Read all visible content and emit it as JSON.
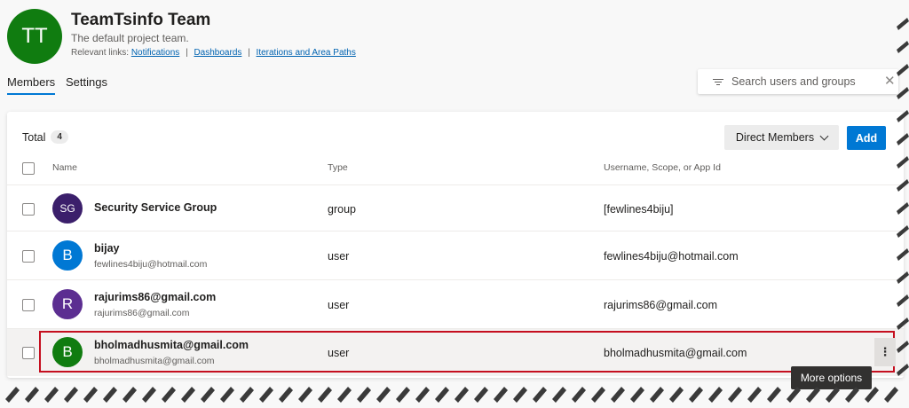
{
  "team": {
    "initials": "TT",
    "name": "TeamTsinfo Team",
    "description": "The default project team.",
    "relevant_label": "Relevant links:",
    "links": [
      "Notifications",
      "Dashboards",
      "Iterations and Area Paths"
    ],
    "separator": "|",
    "avatar_color": "#107c10"
  },
  "tabs": [
    {
      "label": "Members",
      "selected": true
    },
    {
      "label": "Settings",
      "selected": false
    }
  ],
  "search": {
    "placeholder": "Search users and groups",
    "value": "",
    "filter_icon": "filter-icon",
    "clear_icon": "close-icon"
  },
  "toolbar": {
    "total_label": "Total",
    "total_count": "4",
    "filter_dropdown_label": "Direct Members",
    "add_label": "Add"
  },
  "table": {
    "columns": [
      "Name",
      "Type",
      "Username, Scope, or App Id"
    ],
    "rows": [
      {
        "initials": "SG",
        "avatar_color": "#3b1f6b",
        "name": "Security Service Group",
        "subtitle": "",
        "type": "group",
        "username": "[fewlines4biju]"
      },
      {
        "initials": "B",
        "avatar_color": "#0078d4",
        "name": "bijay",
        "subtitle": "fewlines4biju@hotmail.com",
        "type": "user",
        "username": "fewlines4biju@hotmail.com"
      },
      {
        "initials": "R",
        "avatar_color": "#5c2e91",
        "name": "rajurims86@gmail.com",
        "subtitle": "rajurims86@gmail.com",
        "type": "user",
        "username": "rajurims86@gmail.com"
      },
      {
        "initials": "B",
        "avatar_color": "#107c10",
        "name": "bholmadhusmita@gmail.com",
        "subtitle": "bholmadhusmita@gmail.com",
        "type": "user",
        "username": "bholmadhusmita@gmail.com"
      }
    ]
  },
  "more_options": {
    "icon": "more-vertical-icon",
    "glyph": "⋮",
    "tooltip": "More options"
  },
  "colors": {
    "accent": "#0078d4",
    "highlight": "#c50f1f"
  }
}
